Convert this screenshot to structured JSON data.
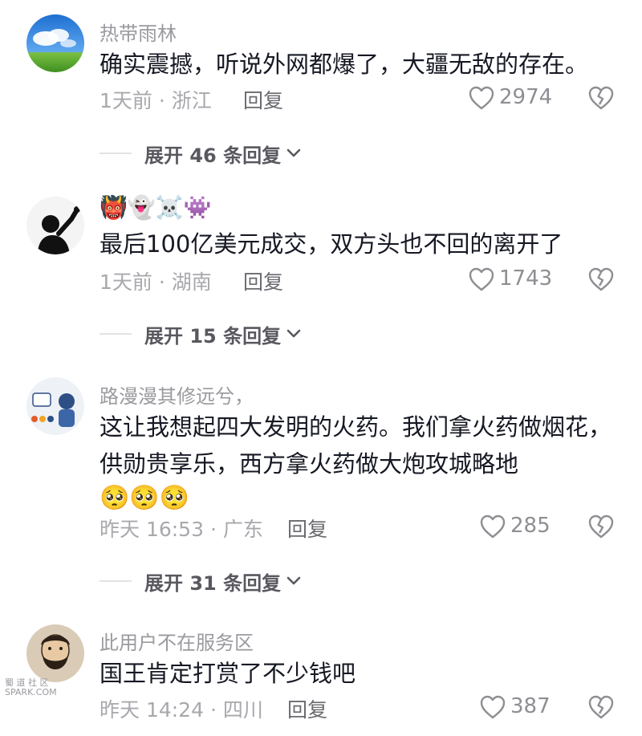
{
  "comments": [
    {
      "username": "热带雨林",
      "emoji": "",
      "text": "确实震撼，听说外网都爆了，大疆无敌的存在。",
      "reactions": "",
      "meta": "1天前 · 浙江",
      "reply_label": "回复",
      "likes": "2974",
      "expand_label": "展开 46 条回复"
    },
    {
      "username": "",
      "emoji": "👹👻☠️👾",
      "text": "最后100亿美元成交，双方头也不回的离开了",
      "reactions": "",
      "meta": "1天前 · 湖南",
      "reply_label": "回复",
      "likes": "1743",
      "expand_label": "展开 15 条回复"
    },
    {
      "username": "路漫漫其修远兮，",
      "emoji": "",
      "text": "这让我想起四大发明的火药。我们拿火药做烟花，供勋贵享乐，西方拿火药做大炮攻城略地",
      "reactions": "🥺🥺🥺",
      "meta": "昨天 16:53 · 广东",
      "reply_label": "回复",
      "likes": "285",
      "expand_label": "展开 31 条回复"
    },
    {
      "username": "此用户不在服务区",
      "emoji": "",
      "text": "国王肯定打赏了不少钱吧",
      "reactions": "",
      "meta": "昨天 14:24 · 四川",
      "reply_label": "回复",
      "likes": "387",
      "expand_label": ""
    }
  ],
  "watermark": {
    "line1": "蜀 道 社 区",
    "line2": "SPARK.COM"
  },
  "colors": {
    "text": "#161823",
    "muted": "#a8a8ad",
    "icon": "#8e8e93"
  }
}
